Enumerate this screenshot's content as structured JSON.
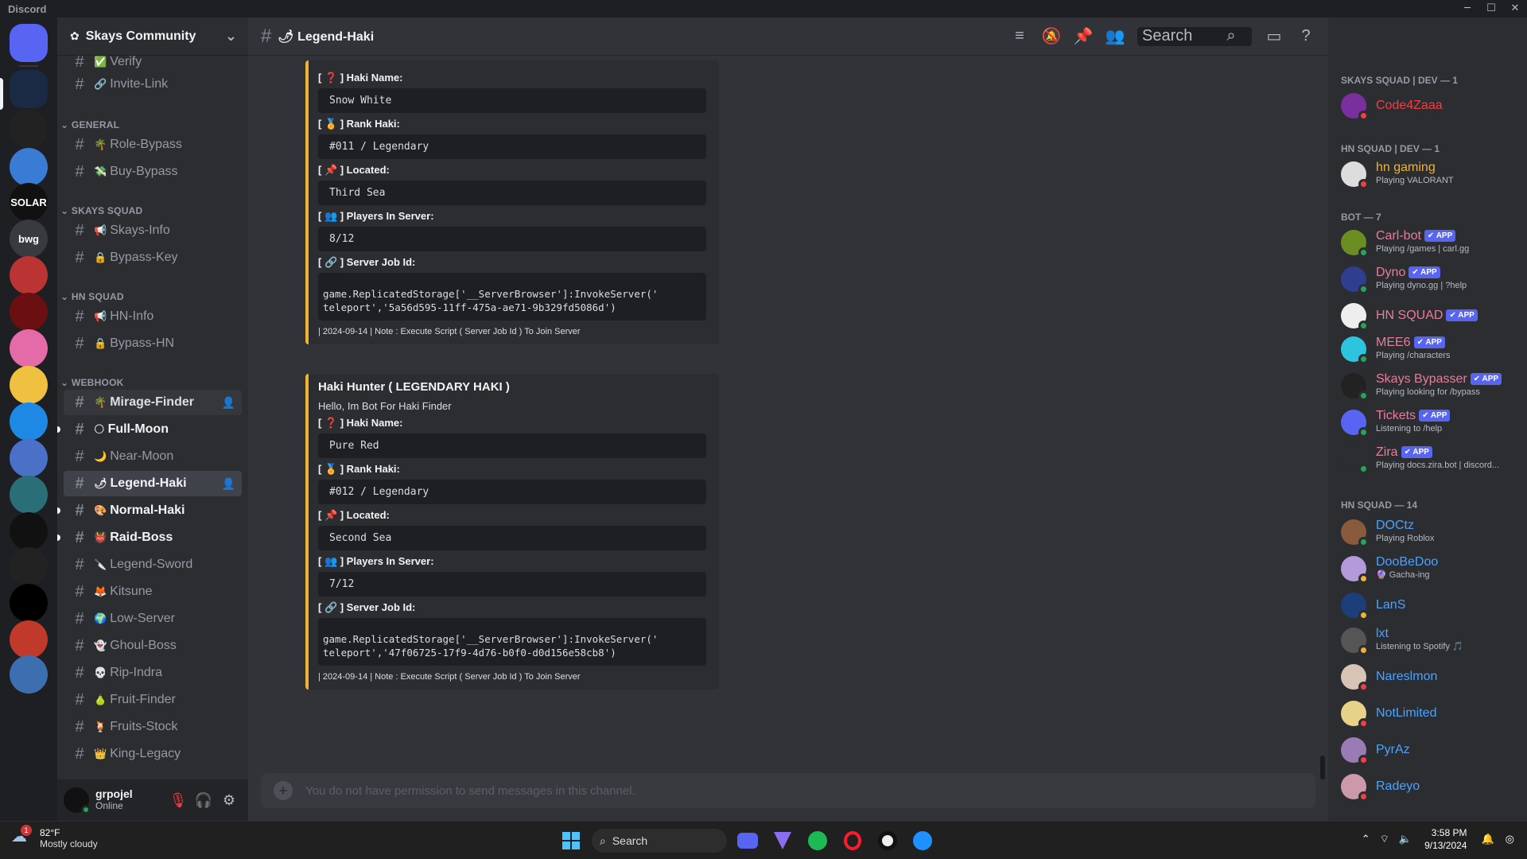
{
  "window": {
    "title": "Discord",
    "controls": [
      "─",
      "☐",
      "✕"
    ]
  },
  "guilds": [
    {
      "name": "discord-home",
      "label": "",
      "bg": "#5865f2"
    },
    {
      "name": "guild-1",
      "label": "",
      "bg": "#1a2a44"
    },
    {
      "name": "guild-2",
      "label": "",
      "bg": "#222"
    },
    {
      "name": "guild-3",
      "label": "",
      "bg": "#3a7bd5"
    },
    {
      "name": "guild-solar",
      "label": "SOLAR",
      "bg": "#111"
    },
    {
      "name": "guild-bwg",
      "label": "bwg",
      "bg": "#383a40"
    },
    {
      "name": "guild-6",
      "label": "",
      "bg": "#b33"
    },
    {
      "name": "guild-eternal",
      "label": "",
      "bg": "#6b0f12"
    },
    {
      "name": "guild-kuromi",
      "label": "",
      "bg": "#e56ba8"
    },
    {
      "name": "guild-9",
      "label": "",
      "bg": "#f0c040"
    },
    {
      "name": "guild-10",
      "label": "",
      "bg": "#1e88e5"
    },
    {
      "name": "guild-11",
      "label": "",
      "bg": "#4a70c8"
    },
    {
      "name": "guild-12",
      "label": "",
      "bg": "#2a6e78"
    },
    {
      "name": "guild-13",
      "label": "",
      "bg": "#111"
    },
    {
      "name": "guild-solara",
      "label": "",
      "bg": "#222"
    },
    {
      "name": "guild-15",
      "label": "",
      "bg": "#000"
    },
    {
      "name": "guild-16",
      "label": "",
      "bg": "#c0392b"
    },
    {
      "name": "guild-17",
      "label": "",
      "bg": "#3d6fb0"
    }
  ],
  "server": {
    "name": "Skays Community",
    "chevron": "⌄"
  },
  "categories": [
    "GENERAL",
    "SKAYS SQUAD",
    "HN SQUAD",
    "WEBHOOK"
  ],
  "channels": [
    {
      "emoji": "✅",
      "name": "Verify"
    },
    {
      "emoji": "🔗",
      "name": "Invite-Link"
    },
    {
      "emoji": "🌴",
      "name": "Role-Bypass"
    },
    {
      "emoji": "💸",
      "name": "Buy-Bypass"
    },
    {
      "emoji": "📢",
      "name": "Skays-Info"
    },
    {
      "emoji": "🔒",
      "name": "Bypass-Key"
    },
    {
      "emoji": "📢",
      "name": "HN-Info"
    },
    {
      "emoji": "🔒",
      "name": "Bypass-HN"
    },
    {
      "emoji": "🌴",
      "name": "Mirage-Finder"
    },
    {
      "emoji": "🌕",
      "name": "Full-Moon"
    },
    {
      "emoji": "🌙",
      "name": "Near-Moon"
    },
    {
      "emoji": "🌶",
      "name": "Legend-Haki"
    },
    {
      "emoji": "🎨",
      "name": "Normal-Haki"
    },
    {
      "emoji": "👹",
      "name": "Raid-Boss"
    },
    {
      "emoji": "🔪",
      "name": "Legend-Sword"
    },
    {
      "emoji": "🦊",
      "name": "Kitsune"
    },
    {
      "emoji": "🌍",
      "name": "Low-Server"
    },
    {
      "emoji": "👻",
      "name": "Ghoul-Boss"
    },
    {
      "emoji": "💀",
      "name": "Rip-Indra"
    },
    {
      "emoji": "🍐",
      "name": "Fruit-Finder"
    },
    {
      "emoji": "🍹",
      "name": "Fruits-Stock"
    },
    {
      "emoji": "👑",
      "name": "King-Legacy"
    }
  ],
  "user": {
    "name": "grpojel",
    "status": "Online"
  },
  "channel_header": {
    "emoji": "🌶",
    "name": "Legend-Haki",
    "search_placeholder": "Search"
  },
  "embeds": [
    {
      "title": "",
      "desc": "",
      "fields": [
        {
          "label": "[ ❓ ] Haki Name:",
          "value": "Snow White"
        },
        {
          "label": "[ 🏅 ] Rank Haki:",
          "value": "#011 / Legendary"
        },
        {
          "label": "[ 📌 ] Located:",
          "value": "Third Sea"
        },
        {
          "label": "[ 👥 ] Players In Server:",
          "value": "8/12"
        }
      ],
      "job_label": "[ 🔗 ] Server Job Id:",
      "job_code": "game.ReplicatedStorage['__ServerBrowser']:InvokeServer('\nteleport','5a56d595-11ff-475a-ae71-9b329fd5086d')",
      "footer": "| 2024-09-14 | Note : Execute Script ( Server Job Id ) To Join Server"
    },
    {
      "title": "Haki Hunter ( LEGENDARY HAKI )",
      "desc": "Hello, Im Bot For Haki Finder",
      "fields": [
        {
          "label": "[ ❓ ] Haki Name:",
          "value": "Pure Red"
        },
        {
          "label": "[ 🏅 ] Rank Haki:",
          "value": "#012 / Legendary"
        },
        {
          "label": "[ 📌 ] Located:",
          "value": "Second Sea"
        },
        {
          "label": "[ 👥 ] Players In Server:",
          "value": "7/12"
        }
      ],
      "job_label": "[ 🔗 ] Server Job Id:",
      "job_code": "game.ReplicatedStorage['__ServerBrowser']:InvokeServer('\nteleport','47f06725-17f9-4d76-b0f0-d0d156e58cb8')",
      "footer": "| 2024-09-14 | Note : Execute Script ( Server Job Id ) To Join Server"
    }
  ],
  "composer": {
    "placeholder": "You do not have permission to send messages in this channel."
  },
  "member_categories": [
    "SKAYS SQUAD | DEV — 1",
    "HN SQUAD | DEV — 1",
    "BOT — 7",
    "HN SQUAD — 14"
  ],
  "members": [
    {
      "name": "Code4Zaaa",
      "activity": "",
      "color": "#f23f43",
      "app": false,
      "status": "#f23f43",
      "av": "#7a2f9e"
    },
    {
      "name": "hn gaming",
      "activity": "Playing VALORANT",
      "color": "#f0b232",
      "app": false,
      "status": "#f23f43",
      "av": "#ddd"
    },
    {
      "name": "Carl-bot",
      "activity": "Playing /games | carl.gg",
      "color": "#e67e9b",
      "app": true,
      "status": "#23a55a",
      "av": "#6b8e23"
    },
    {
      "name": "Dyno",
      "activity": "Playing dyno.gg | ?help",
      "color": "#e67e9b",
      "app": true,
      "status": "#23a55a",
      "av": "#2f3e8f"
    },
    {
      "name": "HN SQUAD",
      "activity": "",
      "color": "#e67e9b",
      "app": true,
      "status": "#23a55a",
      "av": "#eee"
    },
    {
      "name": "MEE6",
      "activity": "Playing /characters",
      "color": "#e67e9b",
      "app": true,
      "status": "#23a55a",
      "av": "#2ec4e0"
    },
    {
      "name": "Skays Bypasser",
      "activity": "Playing looking for /bypass",
      "color": "#e67e9b",
      "app": true,
      "status": "#23a55a",
      "av": "#222"
    },
    {
      "name": "Tickets",
      "activity": "Listening to /help",
      "color": "#e67e9b",
      "app": true,
      "status": "#23a55a",
      "av": "#5865f2"
    },
    {
      "name": "Zira",
      "activity": "Playing docs.zira.bot | discord...",
      "color": "#e67e9b",
      "app": true,
      "status": "#23a55a",
      "av": "#2b2d31"
    },
    {
      "name": "DOCtz",
      "activity": "Playing Roblox",
      "color": "#4aa3ff",
      "app": false,
      "status": "#23a55a",
      "av": "#8a5a3c"
    },
    {
      "name": "DooBeDoo",
      "activity": "🔮 Gacha-ing",
      "color": "#4aa3ff",
      "app": false,
      "status": "#f0b232",
      "av": "#b49adb"
    },
    {
      "name": "LanS",
      "activity": "",
      "color": "#4aa3ff",
      "app": false,
      "status": "#f0b232",
      "av": "#1c3f7a"
    },
    {
      "name": "lxt",
      "activity": "Listening to Spotify 🎵",
      "color": "#4aa3ff",
      "app": false,
      "status": "#f0b232",
      "av": "#555"
    },
    {
      "name": "Nareslmon",
      "activity": "",
      "color": "#4aa3ff",
      "app": false,
      "status": "#f23f43",
      "av": "#d8c3b5"
    },
    {
      "name": "NotLimited",
      "activity": "",
      "color": "#4aa3ff",
      "app": false,
      "status": "#f23f43",
      "av": "#e8d28a"
    },
    {
      "name": "PyrAz",
      "activity": "",
      "color": "#4aa3ff",
      "app": false,
      "status": "#f23f43",
      "av": "#9b7bb5"
    },
    {
      "name": "Radeyo",
      "activity": "",
      "color": "#4aa3ff",
      "app": false,
      "status": "#f23f43",
      "av": "#c9a"
    }
  ],
  "taskbar": {
    "weather_temp": "82°F",
    "weather_desc": "Mostly cloudy",
    "weather_badge": "1",
    "search": "Search",
    "time": "3:58 PM",
    "date": "9/13/2024"
  },
  "icons": {
    "threads": "#",
    "mute": "🔕",
    "pin": "📌",
    "members": "👥",
    "inbox": "▭",
    "help": "?",
    "search": "⌕",
    "mic": "🎤",
    "headphones": "🎧",
    "settings": "⚙",
    "add": "+"
  }
}
